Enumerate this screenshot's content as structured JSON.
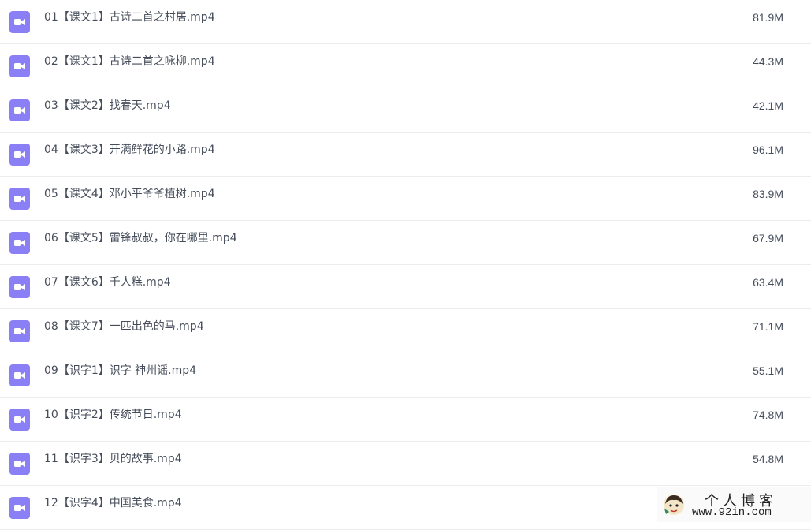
{
  "files": [
    {
      "name": "01【课文1】古诗二首之村居.mp4",
      "size": "81.9M",
      "icon": "video-file-icon"
    },
    {
      "name": "02【课文1】古诗二首之咏柳.mp4",
      "size": "44.3M",
      "icon": "video-file-icon"
    },
    {
      "name": "03【课文2】找春天.mp4",
      "size": "42.1M",
      "icon": "video-file-icon"
    },
    {
      "name": "04【课文3】开满鲜花的小路.mp4",
      "size": "96.1M",
      "icon": "video-file-icon"
    },
    {
      "name": "05【课文4】邓小平爷爷植树.mp4",
      "size": "83.9M",
      "icon": "video-file-icon"
    },
    {
      "name": "06【课文5】雷锋叔叔，你在哪里.mp4",
      "size": "67.9M",
      "icon": "video-file-icon"
    },
    {
      "name": "07【课文6】千人糕.mp4",
      "size": "63.4M",
      "icon": "video-file-icon"
    },
    {
      "name": "08【课文7】一匹出色的马.mp4",
      "size": "71.1M",
      "icon": "video-file-icon"
    },
    {
      "name": "09【识字1】识字 神州谣.mp4",
      "size": "55.1M",
      "icon": "video-file-icon"
    },
    {
      "name": "10【识字2】传统节日.mp4",
      "size": "74.8M",
      "icon": "video-file-icon"
    },
    {
      "name": "11【识字3】贝的故事.mp4",
      "size": "54.8M",
      "icon": "video-file-icon"
    },
    {
      "name": "12【识字4】中国美食.mp4",
      "size": "",
      "icon": "video-file-icon"
    }
  ],
  "colors": {
    "icon": "#8b7ff5",
    "text": "#454d5a",
    "divider": "#ececec"
  },
  "watermark": {
    "title": "个人博客",
    "url": "www.92in.com",
    "icon": "avatar-logo-icon"
  }
}
